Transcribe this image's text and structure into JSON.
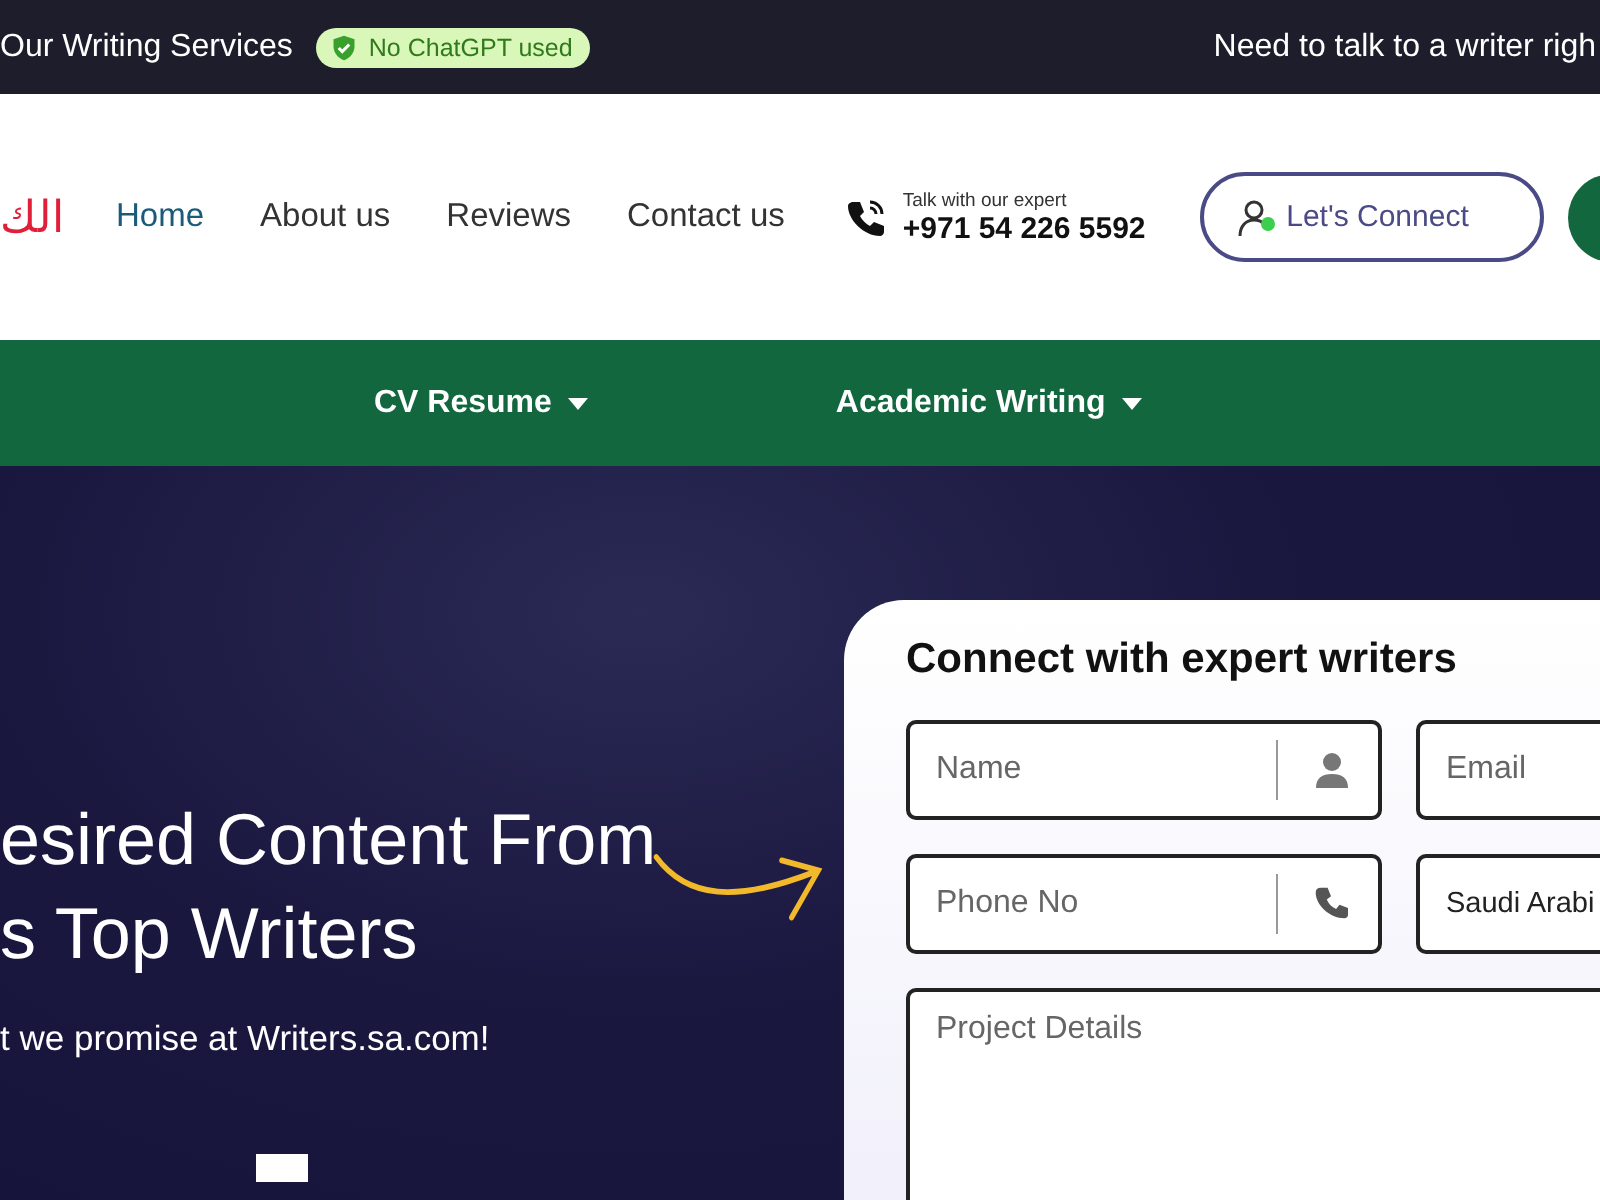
{
  "top_bar": {
    "services_link": "Our Writing Services",
    "badge": "No ChatGPT used",
    "contact_prompt": "Need to talk to a writer righ"
  },
  "header": {
    "logo": "الك",
    "nav": [
      {
        "label": "Home",
        "selected": true
      },
      {
        "label": "About us",
        "selected": false
      },
      {
        "label": "Reviews",
        "selected": false
      },
      {
        "label": "Contact us",
        "selected": false
      }
    ],
    "phone": {
      "caption": "Talk with our expert",
      "number": "+971 54 226 5592"
    },
    "connect_button": "Let's Connect"
  },
  "menu": [
    {
      "label": "CV Resume"
    },
    {
      "label": "Academic Writing"
    }
  ],
  "hero": {
    "headline_lines": [
      "esired Content From",
      "s Top Writers"
    ],
    "subtitle": "t we promise at Writers.sa.com!"
  },
  "form": {
    "title": "Connect with expert writers",
    "fields": [
      {
        "kind": "person",
        "placeholder": "Name"
      },
      {
        "kind": "plain",
        "placeholder": "Email"
      },
      {
        "kind": "phone",
        "placeholder": "Phone No"
      },
      {
        "kind": "select",
        "value": "Saudi Arabi"
      },
      {
        "kind": "textarea",
        "placeholder": "Project Details"
      }
    ]
  }
}
